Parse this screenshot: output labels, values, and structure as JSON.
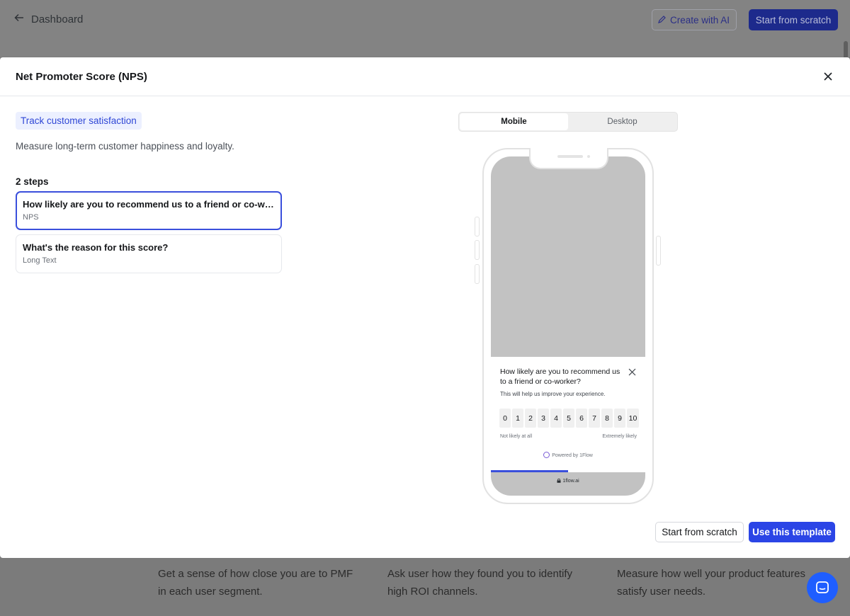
{
  "background": {
    "back_label": "Dashboard",
    "create_ai_label": "Create with AI",
    "start_scratch_label": "Start from scratch",
    "cards": [
      "Get a sense of how close you are to PMF in each user segment.",
      "Ask user how they found you to identify high ROI channels.",
      "Measure how well your product features satisfy user needs."
    ]
  },
  "modal": {
    "title": "Net Promoter Score (NPS)",
    "tag": "Track customer satisfaction",
    "description": "Measure long-term customer happiness and loyalty.",
    "steps_label": "2 steps",
    "steps": [
      {
        "title": "How likely are you to recommend us to a friend or co-worker?",
        "type": "NPS"
      },
      {
        "title": "What's the reason for this score?",
        "type": "Long Text"
      }
    ],
    "view_toggle": {
      "mobile": "Mobile",
      "desktop": "Desktop",
      "selected": "Mobile"
    },
    "preview": {
      "question": "How likely are you to recommend us to a friend or co-worker?",
      "subtext": "This will help us improve your experience.",
      "scale": [
        "0",
        "1",
        "2",
        "3",
        "4",
        "5",
        "6",
        "7",
        "8",
        "9",
        "10"
      ],
      "low_label": "Not likely at all",
      "high_label": "Extremely likely",
      "powered_by": "Powered by 1Flow",
      "progress_fraction": 0.5,
      "url": "1flow.ai"
    },
    "footer": {
      "start_scratch": "Start from scratch",
      "use_template": "Use this template"
    }
  },
  "colors": {
    "accent": "#2b45e6",
    "tag_bg": "#ecf0ff",
    "overlay": "#7d7d7d"
  }
}
